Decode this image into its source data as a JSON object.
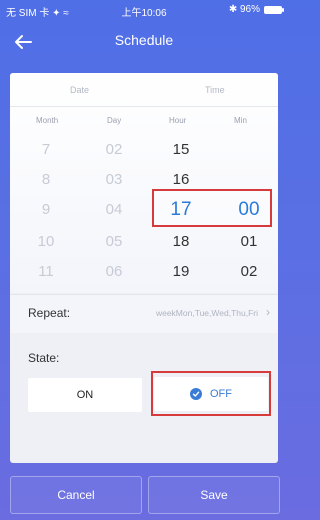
{
  "status": {
    "carrier": "无 SIM 卡 ✦ ≈",
    "time": "上午10:06",
    "bluetooth_battery": "✱ 96%"
  },
  "header": {
    "title": "Schedule"
  },
  "picker": {
    "group_labels": {
      "date": "Date",
      "time": "Time"
    },
    "columns": [
      "Month",
      "Day",
      "Hour",
      "Min"
    ],
    "month": [
      "7",
      "8",
      "9",
      "10",
      "11"
    ],
    "day": [
      "02",
      "03",
      "04",
      "05",
      "06"
    ],
    "hour": [
      "15",
      "16",
      "17",
      "18",
      "19"
    ],
    "min": [
      "",
      "",
      "00",
      "01",
      "02"
    ]
  },
  "repeat": {
    "label": "Repeat:",
    "value": "weekMon,Tue,Wed,Thu,Fri"
  },
  "state": {
    "label": "State:",
    "on": "ON",
    "off": "OFF",
    "selected": "OFF"
  },
  "footer": {
    "cancel": "Cancel",
    "save": "Save"
  },
  "colors": {
    "accent": "#3a7bd5",
    "selected_text": "#2a7bd8",
    "highlight": "#d73a3a"
  }
}
